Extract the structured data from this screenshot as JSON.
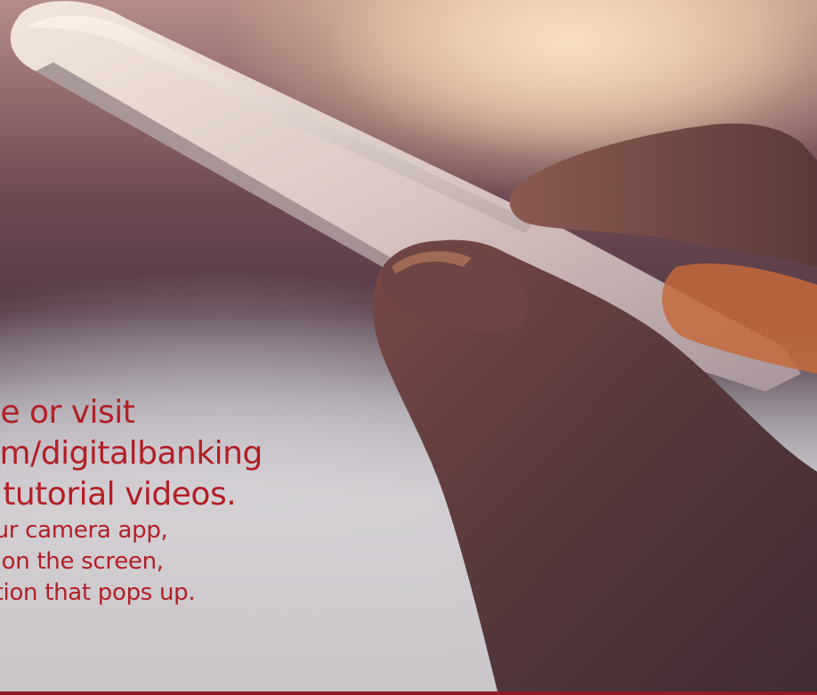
{
  "overlay": {
    "lines_large": [
      "de or visit",
      "om/digitalbanking",
      "r tutorial videos."
    ],
    "lines_small": [
      "our camera app,",
      "e on the screen,",
      "ation that pops up."
    ],
    "text_color": "#b21f24"
  },
  "scene": {
    "subject": "hand holding smartphone",
    "rule_color": "#8a1e22"
  }
}
